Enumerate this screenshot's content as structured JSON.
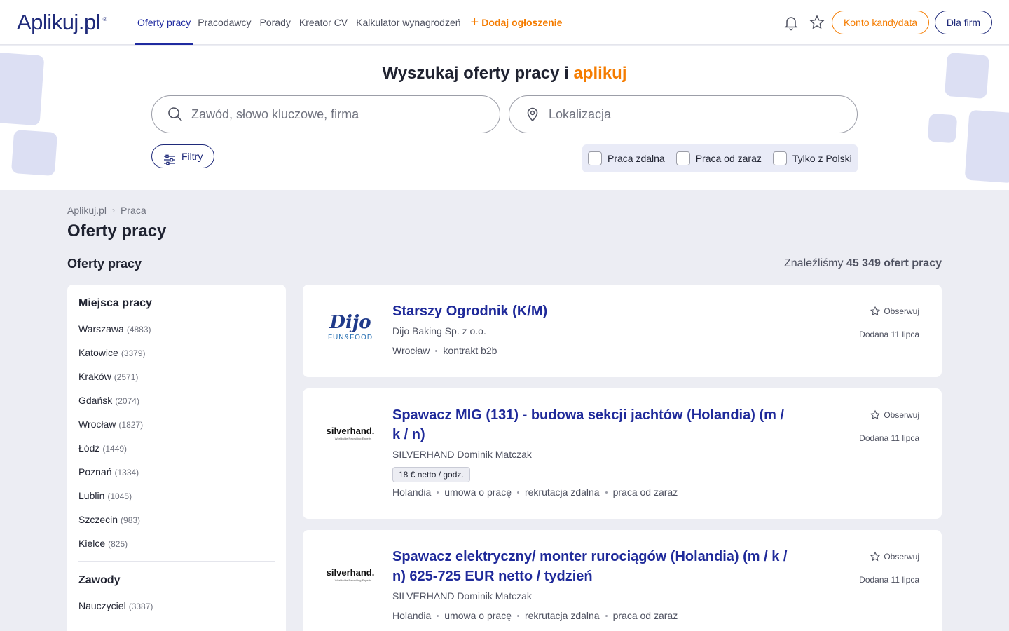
{
  "header": {
    "logo_main": "Aplikuj",
    "logo_tld": ".pl",
    "logo_reg": "®",
    "nav": [
      {
        "label": "Oferty pracy",
        "active": true
      },
      {
        "label": "Pracodawcy"
      },
      {
        "label": "Porady"
      },
      {
        "label": "Kreator CV"
      },
      {
        "label": "Kalkulator wynagrodzeń"
      }
    ],
    "add_listing": "Dodaj ogłoszenie",
    "candidate_account": "Konto kandydata",
    "for_companies": "Dla firm",
    "icons": [
      "bell-icon",
      "star-icon"
    ]
  },
  "search": {
    "title_prefix": "Wyszukaj oferty pracy i",
    "title_accent": "aplikuj",
    "keyword_placeholder": "Zawód, słowo kluczowe, firma",
    "location_placeholder": "Lokalizacja",
    "filters_label": "Filtry",
    "checkboxes": [
      "Praca zdalna",
      "Praca od zaraz",
      "Tylko z Polski"
    ]
  },
  "breadcrumb": [
    "Aplikuj.pl",
    "Praca"
  ],
  "page_title": "Oferty pracy",
  "section_title": "Oferty pracy",
  "results": {
    "prefix": "Znaleźliśmy",
    "count": "45 349 ofert pracy"
  },
  "sidebar": {
    "locations_heading": "Miejsca pracy",
    "locations": [
      {
        "name": "Warszawa",
        "count": "(4883)"
      },
      {
        "name": "Katowice",
        "count": "(3379)"
      },
      {
        "name": "Kraków",
        "count": "(2571)"
      },
      {
        "name": "Gdańsk",
        "count": "(2074)"
      },
      {
        "name": "Wrocław",
        "count": "(1827)"
      },
      {
        "name": "Łódź",
        "count": "(1449)"
      },
      {
        "name": "Poznań",
        "count": "(1334)"
      },
      {
        "name": "Lublin",
        "count": "(1045)"
      },
      {
        "name": "Szczecin",
        "count": "(983)"
      },
      {
        "name": "Kielce",
        "count": "(825)"
      }
    ],
    "professions_heading": "Zawody",
    "professions": [
      {
        "name": "Nauczyciel",
        "count": "(3387)"
      }
    ]
  },
  "jobs": [
    {
      "title": "Starszy Ogrodnik (K/M)",
      "company": "Dijo Baking Sp. z o.o.",
      "logo_text": "Dijo",
      "logo_sub": "FUN&FOOD",
      "meta": [
        "Wrocław",
        "kontrakt b2b"
      ],
      "watch": "Obserwuj",
      "added": "Dodana 11 lipca"
    },
    {
      "title": "Spawacz MIG (131) - budowa sekcji jachtów (Holandia) (m / k / n)",
      "company": "SILVERHAND Dominik Matczak",
      "logo_text": "silverhand.",
      "logo_sub": "Worldwide Recruiting Experts",
      "salary": "18 € netto / godz.",
      "meta": [
        "Holandia",
        "umowa o pracę",
        "rekrutacja zdalna",
        "praca od zaraz"
      ],
      "watch": "Obserwuj",
      "added": "Dodana 11 lipca"
    },
    {
      "title": "Spawacz elektryczny/ monter rurociągów (Holandia) (m / k / n) 625-725 EUR netto / tydzień",
      "company": "SILVERHAND Dominik Matczak",
      "logo_text": "silverhand.",
      "logo_sub": "Worldwide Recruiting Experts",
      "meta": [
        "Holandia",
        "umowa o pracę",
        "rekrutacja zdalna",
        "praca od zaraz"
      ],
      "watch": "Obserwuj",
      "added": "Dodana 11 lipca"
    }
  ],
  "colors": {
    "brand_blue": "#1f2a7a",
    "accent_orange": "#f57c00",
    "link_blue": "#1f2a9a"
  }
}
